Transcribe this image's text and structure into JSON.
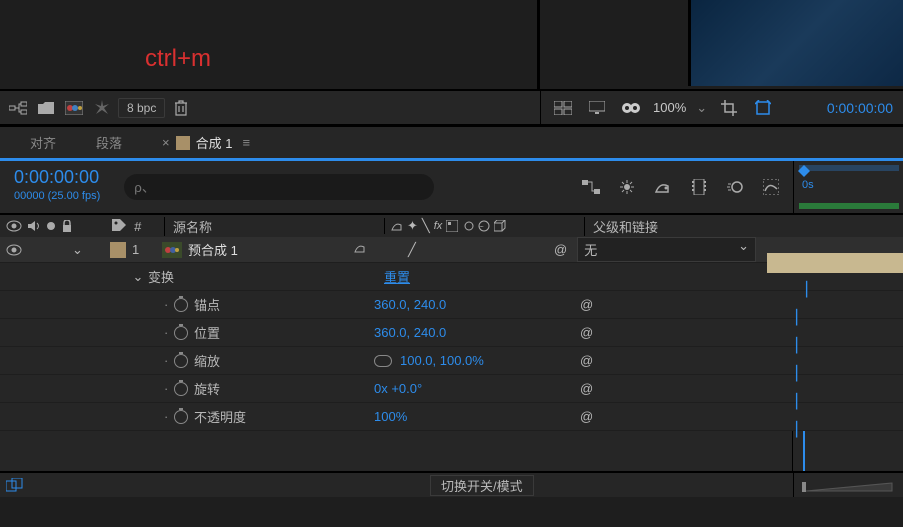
{
  "overlay_text": "ctrl+m",
  "toolbar": {
    "bpc_label": "8 bpc",
    "zoom": "100%",
    "timecode": "0:00:00:00"
  },
  "tabs": {
    "align": "对齐",
    "paragraph": "段落",
    "comp": "合成 1"
  },
  "timeline": {
    "timecode": "0:00:00:00",
    "frame_info": "00000 (25.00 fps)",
    "search_placeholder": "ρ、"
  },
  "columns": {
    "source_name": "源名称",
    "parent_link": "父级和链接",
    "num_symbol": "#"
  },
  "layer": {
    "index": "1",
    "name": "预合成 1",
    "parent_none": "无"
  },
  "transform": {
    "group": "变换",
    "reset": "重置",
    "anchor": {
      "label": "锚点",
      "value": "360.0, 240.0"
    },
    "position": {
      "label": "位置",
      "value": "360.0, 240.0"
    },
    "scale": {
      "label": "缩放",
      "value": "100.0, 100.0%"
    },
    "rotation": {
      "label": "旋转",
      "value": "0x +0.0°"
    },
    "opacity": {
      "label": "不透明度",
      "value": "100%"
    }
  },
  "footer": {
    "toggle": "切换开关/模式"
  },
  "ruler": {
    "s0": "0s"
  }
}
